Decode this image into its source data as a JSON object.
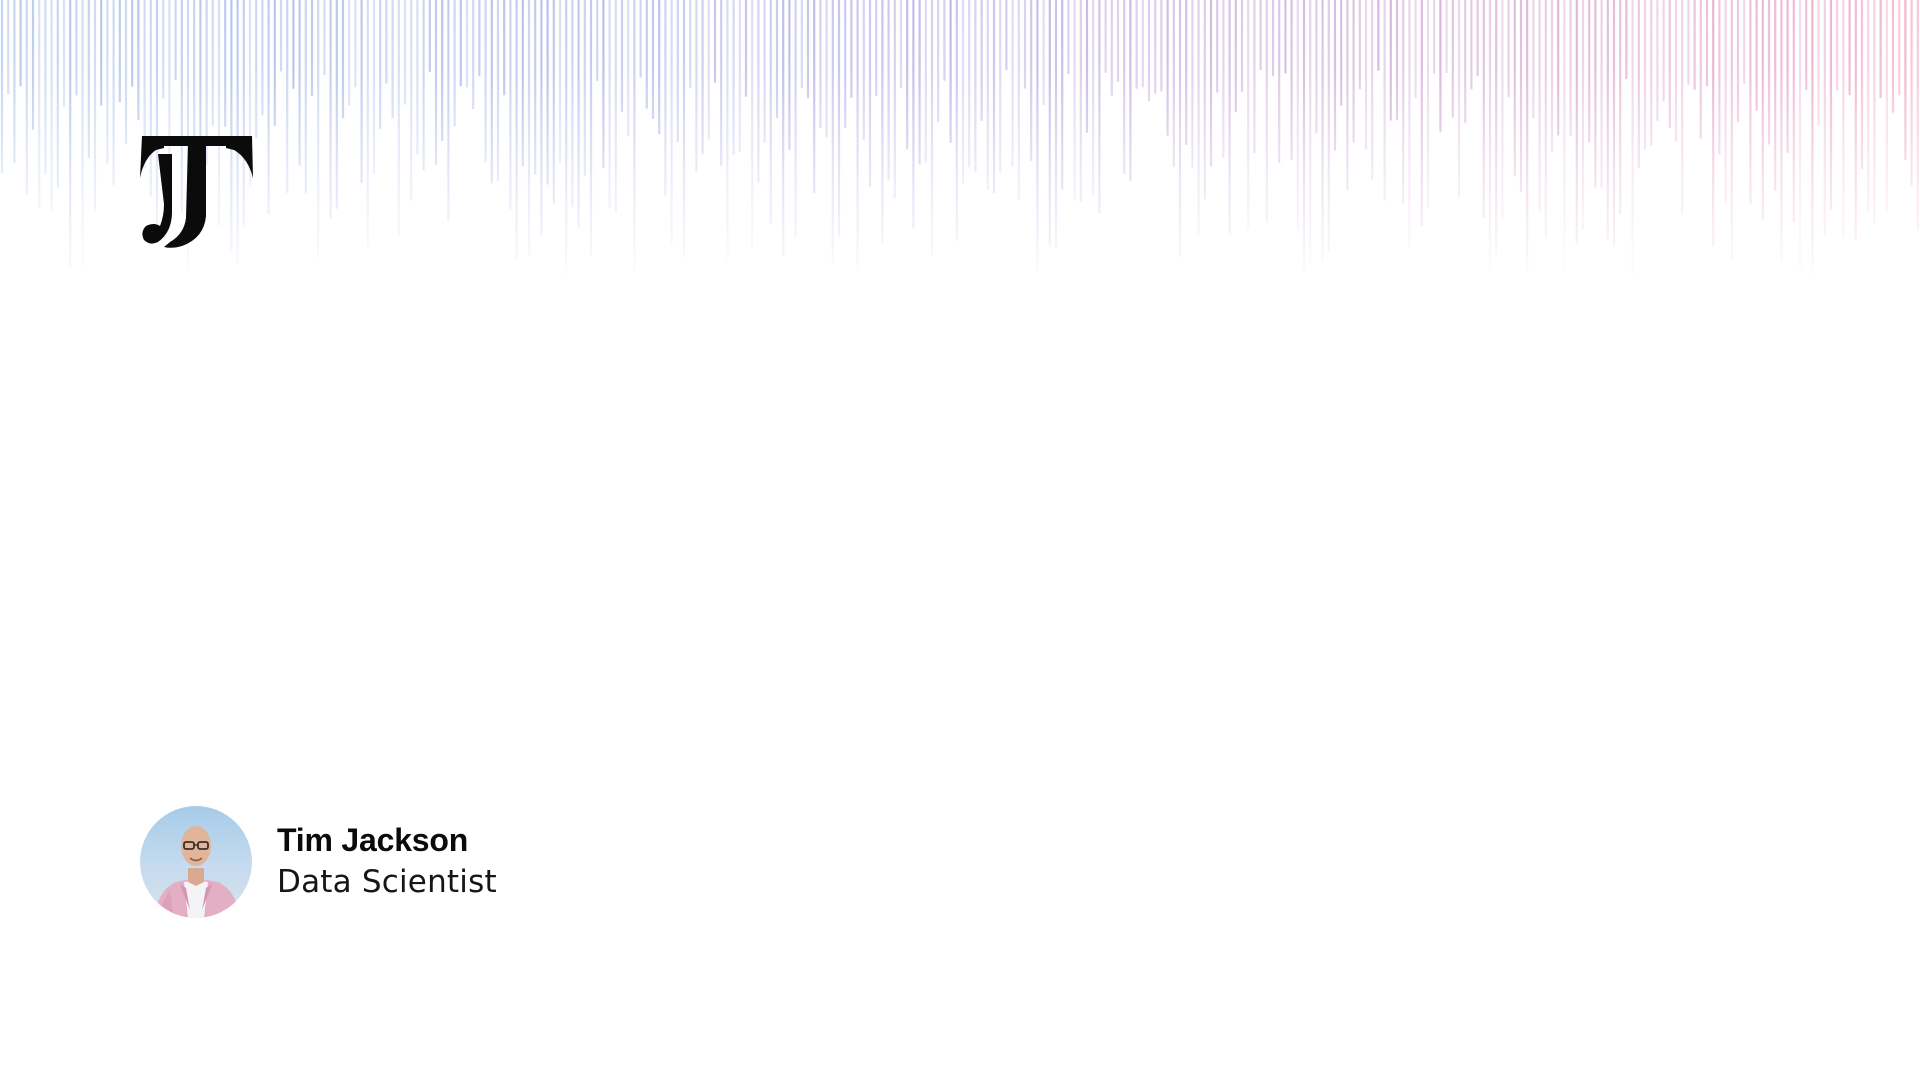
{
  "author": {
    "name": "Tim Jackson",
    "role": "Data Scientist"
  },
  "icons": {
    "logo": "jt-monogram-logo",
    "avatar": "author-photo"
  },
  "colors": {
    "background": "#ffffff",
    "lines_start": "#a9c4ea",
    "lines_mid": "#b9b2e8",
    "lines_end": "#f1a9c6",
    "text": "#0b0b0b"
  }
}
